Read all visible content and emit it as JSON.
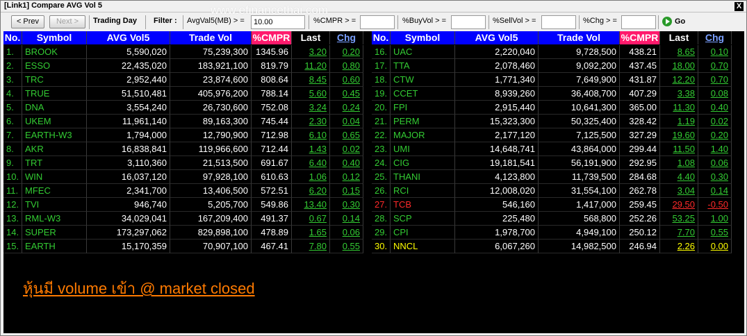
{
  "window": {
    "title": "[Link1] Compare AVG Vol 5",
    "close_label": "X"
  },
  "toolbar": {
    "prev_label": "< Prev",
    "next_label": "Next >",
    "trading_day_label": "Trading Day",
    "filter_label": "Filter :",
    "avgval_label": "AvgVal5(MB) > =",
    "avgval_value": "10.00",
    "cmpr_label": "%CMPR > =",
    "cmpr_value": "",
    "buyvol_label": "%BuyVol > =",
    "buyvol_value": "",
    "sellvol_label": "%SellVol > =",
    "sellvol_value": "",
    "chg_label": "%Chg > =",
    "chg_value": "",
    "go_label": "Go"
  },
  "watermark": "www.efinancethai.com",
  "columns": [
    "No.",
    "Symbol",
    "AVG Vol5",
    "Trade Vol",
    "%CMPR",
    "Last",
    "Chg"
  ],
  "rows_left": [
    {
      "no": "1.",
      "symbol": "BROOK",
      "avg": "5,590,020",
      "trade": "75,239,300",
      "cmpr": "1345.96",
      "last": "3.20",
      "chg": "0.20",
      "color": "green"
    },
    {
      "no": "2.",
      "symbol": "ESSO",
      "avg": "22,435,020",
      "trade": "183,921,100",
      "cmpr": "819.79",
      "last": "11.20",
      "chg": "0.80",
      "color": "green"
    },
    {
      "no": "3.",
      "symbol": "TRC",
      "avg": "2,952,440",
      "trade": "23,874,600",
      "cmpr": "808.64",
      "last": "8.45",
      "chg": "0.60",
      "color": "green"
    },
    {
      "no": "4.",
      "symbol": "TRUE",
      "avg": "51,510,481",
      "trade": "405,976,200",
      "cmpr": "788.14",
      "last": "5.60",
      "chg": "0.45",
      "color": "green"
    },
    {
      "no": "5.",
      "symbol": "DNA",
      "avg": "3,554,240",
      "trade": "26,730,600",
      "cmpr": "752.08",
      "last": "3.24",
      "chg": "0.24",
      "color": "green"
    },
    {
      "no": "6.",
      "symbol": "UKEM",
      "avg": "11,961,140",
      "trade": "89,163,300",
      "cmpr": "745.44",
      "last": "2.30",
      "chg": "0.04",
      "color": "green"
    },
    {
      "no": "7.",
      "symbol": "EARTH-W3",
      "avg": "1,794,000",
      "trade": "12,790,900",
      "cmpr": "712.98",
      "last": "6.10",
      "chg": "0.65",
      "color": "green"
    },
    {
      "no": "8.",
      "symbol": "AKR",
      "avg": "16,838,841",
      "trade": "119,966,600",
      "cmpr": "712.44",
      "last": "1.43",
      "chg": "0.02",
      "color": "green"
    },
    {
      "no": "9.",
      "symbol": "TRT",
      "avg": "3,110,360",
      "trade": "21,513,500",
      "cmpr": "691.67",
      "last": "6.40",
      "chg": "0.40",
      "color": "green"
    },
    {
      "no": "10.",
      "symbol": "WIN",
      "avg": "16,037,120",
      "trade": "97,928,100",
      "cmpr": "610.63",
      "last": "1.06",
      "chg": "0.12",
      "color": "green"
    },
    {
      "no": "11.",
      "symbol": "MFEC",
      "avg": "2,341,700",
      "trade": "13,406,500",
      "cmpr": "572.51",
      "last": "6.20",
      "chg": "0.15",
      "color": "green"
    },
    {
      "no": "12.",
      "symbol": "TVI",
      "avg": "946,740",
      "trade": "5,205,700",
      "cmpr": "549.86",
      "last": "13.40",
      "chg": "0.30",
      "color": "green"
    },
    {
      "no": "13.",
      "symbol": "RML-W3",
      "avg": "34,029,041",
      "trade": "167,209,400",
      "cmpr": "491.37",
      "last": "0.67",
      "chg": "0.14",
      "color": "green"
    },
    {
      "no": "14.",
      "symbol": "SUPER",
      "avg": "173,297,062",
      "trade": "829,898,100",
      "cmpr": "478.89",
      "last": "1.65",
      "chg": "0.06",
      "color": "green"
    },
    {
      "no": "15.",
      "symbol": "EARTH",
      "avg": "15,170,359",
      "trade": "70,907,100",
      "cmpr": "467.41",
      "last": "7.80",
      "chg": "0.55",
      "color": "green"
    }
  ],
  "rows_right": [
    {
      "no": "16.",
      "symbol": "UAC",
      "avg": "2,220,040",
      "trade": "9,728,500",
      "cmpr": "438.21",
      "last": "8.65",
      "chg": "0.10",
      "color": "green"
    },
    {
      "no": "17.",
      "symbol": "TTA",
      "avg": "2,078,460",
      "trade": "9,092,200",
      "cmpr": "437.45",
      "last": "18.00",
      "chg": "0.70",
      "color": "green"
    },
    {
      "no": "18.",
      "symbol": "CTW",
      "avg": "1,771,340",
      "trade": "7,649,900",
      "cmpr": "431.87",
      "last": "12.20",
      "chg": "0.70",
      "color": "green"
    },
    {
      "no": "19.",
      "symbol": "CCET",
      "avg": "8,939,260",
      "trade": "36,408,700",
      "cmpr": "407.29",
      "last": "3.38",
      "chg": "0.08",
      "color": "green"
    },
    {
      "no": "20.",
      "symbol": "FPI",
      "avg": "2,915,440",
      "trade": "10,641,300",
      "cmpr": "365.00",
      "last": "11.30",
      "chg": "0.40",
      "color": "green"
    },
    {
      "no": "21.",
      "symbol": "PERM",
      "avg": "15,323,300",
      "trade": "50,325,400",
      "cmpr": "328.42",
      "last": "1.19",
      "chg": "0.02",
      "color": "green"
    },
    {
      "no": "22.",
      "symbol": "MAJOR",
      "avg": "2,177,120",
      "trade": "7,125,500",
      "cmpr": "327.29",
      "last": "19.60",
      "chg": "0.20",
      "color": "green"
    },
    {
      "no": "23.",
      "symbol": "UMI",
      "avg": "14,648,741",
      "trade": "43,864,000",
      "cmpr": "299.44",
      "last": "11.50",
      "chg": "1.40",
      "color": "green"
    },
    {
      "no": "24.",
      "symbol": "CIG",
      "avg": "19,181,541",
      "trade": "56,191,900",
      "cmpr": "292.95",
      "last": "1.08",
      "chg": "0.06",
      "color": "green"
    },
    {
      "no": "25.",
      "symbol": "THANI",
      "avg": "4,123,800",
      "trade": "11,739,500",
      "cmpr": "284.68",
      "last": "4.40",
      "chg": "0.30",
      "color": "green"
    },
    {
      "no": "26.",
      "symbol": "RCI",
      "avg": "12,008,020",
      "trade": "31,554,100",
      "cmpr": "262.78",
      "last": "3.04",
      "chg": "0.14",
      "color": "green"
    },
    {
      "no": "27.",
      "symbol": "TCB",
      "avg": "546,160",
      "trade": "1,417,000",
      "cmpr": "259.45",
      "last": "29.50",
      "chg": "-0.50",
      "color": "red"
    },
    {
      "no": "28.",
      "symbol": "SCP",
      "avg": "225,480",
      "trade": "568,800",
      "cmpr": "252.26",
      "last": "53.25",
      "chg": "1.00",
      "color": "green"
    },
    {
      "no": "29.",
      "symbol": "CPI",
      "avg": "1,978,700",
      "trade": "4,949,100",
      "cmpr": "250.12",
      "last": "7.70",
      "chg": "0.55",
      "color": "green"
    },
    {
      "no": "30.",
      "symbol": "NNCL",
      "avg": "6,067,260",
      "trade": "14,982,500",
      "cmpr": "246.94",
      "last": "2.26",
      "chg": "0.00",
      "color": "yellow"
    }
  ],
  "note": "หุ้นมี volume เข้า @ market closed",
  "colors": {
    "header_bg": "#0000ff",
    "cmpr_header_bg": "#ff1a6c",
    "up": "#33cc33",
    "down": "#ff2a2a",
    "unchanged": "#ffff00",
    "note": "#ff7a00"
  }
}
